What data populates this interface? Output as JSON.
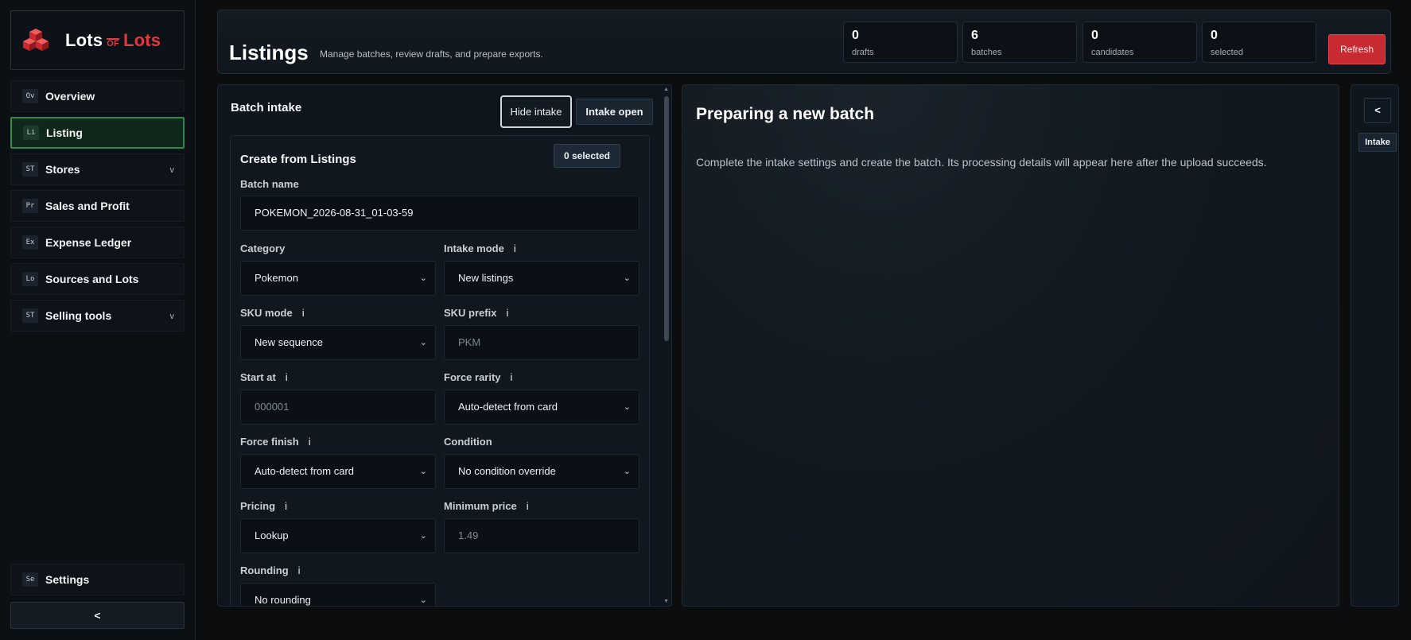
{
  "brand": {
    "word1": "Lots",
    "word2": "OF",
    "word3": "Lots"
  },
  "sidebar": {
    "items": [
      {
        "abbr": "Ov",
        "label": "Overview"
      },
      {
        "abbr": "Li",
        "label": "Listing"
      },
      {
        "abbr": "ST",
        "label": "Stores",
        "chevron": "v"
      },
      {
        "abbr": "Pr",
        "label": "Sales and Profit"
      },
      {
        "abbr": "Ex",
        "label": "Expense Ledger"
      },
      {
        "abbr": "Lo",
        "label": "Sources and Lots"
      },
      {
        "abbr": "ST",
        "label": "Selling tools",
        "chevron": "v"
      }
    ],
    "active_index": 1,
    "settings": {
      "abbr": "Se",
      "label": "Settings"
    },
    "collapse_label": "<"
  },
  "header": {
    "title": "Listings",
    "subtitle": "Manage batches, review drafts, and prepare exports.",
    "stats": [
      {
        "value": "0",
        "label": "drafts"
      },
      {
        "value": "6",
        "label": "batches"
      },
      {
        "value": "0",
        "label": "candidates"
      },
      {
        "value": "0",
        "label": "selected"
      }
    ],
    "refresh_label": "Refresh",
    "refresh_color": "#c82a32"
  },
  "intake": {
    "title": "Batch intake",
    "hide_label": "Hide intake",
    "open_label": "Intake open",
    "create": {
      "title": "Create from Listings",
      "selected_badge": "0 selected",
      "batch_name_label": "Batch name",
      "batch_name_value": "POKEMON_2026-08-31_01-03-59",
      "category_label": "Category",
      "category_value": "Pokemon",
      "intake_mode_label": "Intake mode",
      "intake_mode_value": "New listings",
      "sku_mode_label": "SKU mode",
      "sku_mode_value": "New sequence",
      "sku_prefix_label": "SKU prefix",
      "sku_prefix_placeholder": "PKM",
      "start_at_label": "Start at",
      "start_at_placeholder": "000001",
      "force_rarity_label": "Force rarity",
      "force_rarity_value": "Auto-detect from card",
      "force_finish_label": "Force finish",
      "force_finish_value": "Auto-detect from card",
      "condition_label": "Condition",
      "condition_value": "No condition override",
      "pricing_label": "Pricing",
      "pricing_value": "Lookup",
      "min_price_label": "Minimum price",
      "min_price_placeholder": "1.49",
      "rounding_label": "Rounding",
      "rounding_value": "No rounding",
      "info_glyph": "i",
      "chevron_glyph": "⌄"
    }
  },
  "detail": {
    "title": "Preparing a new batch",
    "text": "Complete the intake settings and create the batch. Its processing details will appear here after the upload succeeds."
  },
  "rail": {
    "back_label": "<",
    "intake_label": "Intake"
  }
}
